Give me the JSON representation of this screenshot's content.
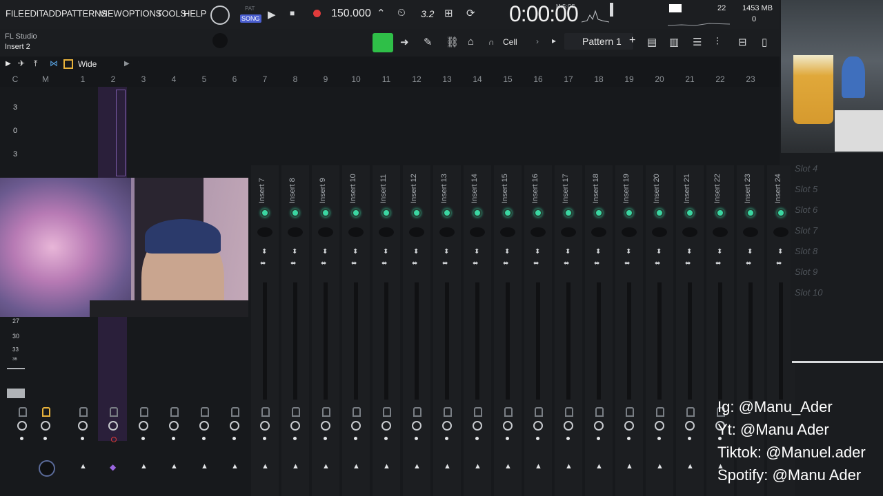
{
  "menu": [
    "FILE",
    "EDIT",
    "ADD",
    "PATTERNS",
    "VIEW",
    "OPTIONS",
    "TOOLS",
    "HELP"
  ],
  "transport": {
    "pat_label": "PAT",
    "song_label": "SONG",
    "tempo": "150.000",
    "time": "0:00:00",
    "time_format": "M:S:CS",
    "step_snap": "3.2",
    "memory": "1453 MB",
    "cpu_voices": "22",
    "cpu_value": "0"
  },
  "hint": {
    "app_name": "FL Studio",
    "selected": "Insert 2"
  },
  "toolbar2": {
    "snap_label": "Cell",
    "pattern_label": "Pattern 1"
  },
  "mixer": {
    "view_mode": "Wide",
    "ruler": [
      "C",
      "M",
      "1",
      "2",
      "3",
      "4",
      "5",
      "6",
      "7",
      "8",
      "9",
      "10",
      "11",
      "12",
      "13",
      "14",
      "15",
      "16",
      "17",
      "18",
      "19",
      "20",
      "21",
      "22",
      "23"
    ],
    "db_scale_top": [
      "3",
      "0",
      "3"
    ],
    "db_scale_bottom": [
      "27",
      "30",
      "33",
      "36"
    ],
    "strips": [
      "Insert 7",
      "Insert 8",
      "Insert 9",
      "Insert 10",
      "Insert 11",
      "Insert 12",
      "Insert 13",
      "Insert 14",
      "Insert 15",
      "Insert 16",
      "Insert 17",
      "Insert 18",
      "Insert 19",
      "Insert 20",
      "Insert 21",
      "Insert 22",
      "Insert 23",
      "Insert 24"
    ],
    "slots": [
      "Slot 4",
      "Slot 5",
      "Slot 6",
      "Slot 7",
      "Slot 8",
      "Slot 9",
      "Slot 10"
    ]
  },
  "social": {
    "ig": "Ig: @Manu_Ader",
    "yt": "Yt: @Manu Ader",
    "tiktok": "Tiktok: @Manuel.ader",
    "spotify": "Spotify: @Manu Ader"
  },
  "colors": {
    "accent_green": "#3bd6a2",
    "record_red": "#e03b3b",
    "selection_purple": "#5b3d8a"
  }
}
